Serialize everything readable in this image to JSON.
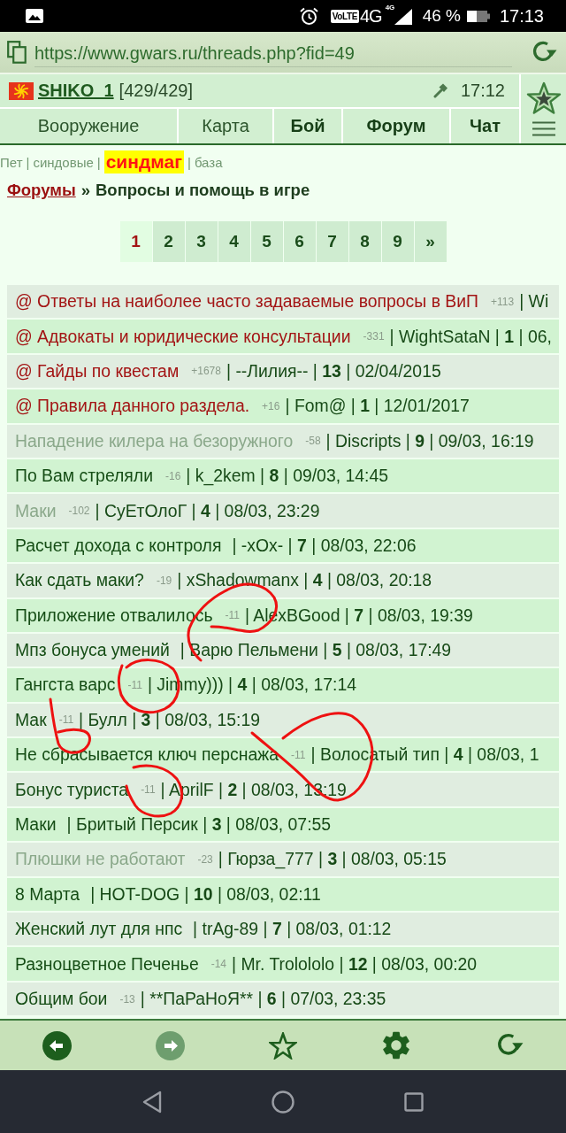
{
  "status_bar": {
    "volte": "VoLTE",
    "network": "4G",
    "network_badge": "4G",
    "battery": "46 %",
    "time": "17:13"
  },
  "address_bar": {
    "url": "https://www.gwars.ru/threads.php?fid=49"
  },
  "header": {
    "user": {
      "name": "SHIKO_1",
      "hp": "[429/429]"
    },
    "time": "17:12",
    "nav": [
      {
        "label": "Вооружение",
        "bold": false
      },
      {
        "label": "Карта",
        "bold": false
      },
      {
        "label": "Бой",
        "bold": true
      },
      {
        "label": "Форум",
        "bold": true
      },
      {
        "label": "Чат",
        "bold": true
      }
    ]
  },
  "quick_links": {
    "separator": "|",
    "items": [
      {
        "label": "Пет",
        "highlighted": false
      },
      {
        "label": "синдовые",
        "highlighted": false
      },
      {
        "label": "синдмаг",
        "highlighted": true
      },
      {
        "label": "база",
        "highlighted": false
      }
    ]
  },
  "breadcrumb": {
    "parent": "Форумы",
    "separator": "»",
    "current": "Вопросы и помощь в игре"
  },
  "pagination": [
    {
      "label": "1",
      "selected": true
    },
    {
      "label": "2",
      "selected": false
    },
    {
      "label": "3",
      "selected": false
    },
    {
      "label": "4",
      "selected": false
    },
    {
      "label": "5",
      "selected": false
    },
    {
      "label": "6",
      "selected": false
    },
    {
      "label": "7",
      "selected": false
    },
    {
      "label": "8",
      "selected": false
    },
    {
      "label": "9",
      "selected": false
    },
    {
      "label": "»",
      "selected": false
    }
  ],
  "thread_list": {
    "separator": "|",
    "rows": [
      {
        "kind": "pinned",
        "title": "@ Ответы на наиболее часто задаваемые вопросы в ВиП",
        "rating": "+113",
        "author": "Wi"
      },
      {
        "kind": "pinned",
        "title": "@ Адвокаты и юридические консультации",
        "rating": "-331",
        "author": "WightSataN",
        "replies": "1",
        "date": "06,"
      },
      {
        "kind": "pinned",
        "title": "@ Гайды по квестам",
        "rating": "+1678",
        "author": "--Лилия--",
        "replies": "13",
        "date": "02/04/2015"
      },
      {
        "kind": "pinned",
        "title": "@ Правила данного раздела.",
        "rating": "+16",
        "author": "Fom@",
        "replies": "1",
        "date": "12/01/2017"
      },
      {
        "kind": "faded",
        "title": "Нападение килера на безоружного",
        "rating": "-58",
        "author": "Discripts",
        "replies": "9",
        "date": "09/03, 16:19"
      },
      {
        "kind": "regular",
        "title": "По Вам стреляли",
        "rating": "-16",
        "author": "k_2kem",
        "replies": "8",
        "date": "09/03, 14:45"
      },
      {
        "kind": "faded",
        "title": "Маки",
        "rating": "-102",
        "author": "СуЕтОлоГ",
        "replies": "4",
        "date": "08/03, 23:29"
      },
      {
        "kind": "regular",
        "title": "Расчет дохода с контроля",
        "author": "-xOx-",
        "replies": "7",
        "date": "08/03, 22:06"
      },
      {
        "kind": "regular",
        "title": "Как сдать маки?",
        "rating": "-19",
        "author": "xShadowmanx",
        "replies": "4",
        "date": "08/03, 20:18"
      },
      {
        "kind": "regular",
        "title": "Приложение отвалилось",
        "rating": "-11",
        "author": "AlexBGood",
        "replies": "7",
        "date": "08/03, 19:39"
      },
      {
        "kind": "regular",
        "title": "Мпз бонуса умений",
        "author": "Варю Пельмени",
        "replies": "5",
        "date": "08/03, 17:49"
      },
      {
        "kind": "regular",
        "title": "Гангста варс",
        "rating": "-11",
        "author": "Jimmy)))",
        "replies": "4",
        "date": "08/03, 17:14"
      },
      {
        "kind": "regular",
        "title": "Мак",
        "rating": "-11",
        "author": "Булл",
        "replies": "3",
        "date": "08/03, 15:19"
      },
      {
        "kind": "regular",
        "title": "Не сбрасывается ключ перснажа",
        "rating": "-11",
        "author": "Волосатый тип",
        "replies": "4",
        "date": "08/03, 1"
      },
      {
        "kind": "regular",
        "title": "Бонус туриста",
        "rating": "-11",
        "author": "AprilF",
        "replies": "2",
        "date": "08/03, 13:19"
      },
      {
        "kind": "regular",
        "title": "Маки",
        "author": "Бритый Персик",
        "replies": "3",
        "date": "08/03, 07:55"
      },
      {
        "kind": "faded",
        "title": "Плюшки не работают",
        "rating": "-23",
        "author": "Гюрза_777",
        "replies": "3",
        "date": "08/03, 05:15"
      },
      {
        "kind": "regular",
        "title": "8 Марта",
        "author": "HOT-DOG",
        "replies": "10",
        "date": "08/03, 02:11"
      },
      {
        "kind": "regular",
        "title": "Женский лут для нпс",
        "author": "trAg-89",
        "replies": "7",
        "date": "08/03, 01:12"
      },
      {
        "kind": "regular",
        "title": "Разноцветное Печенье",
        "rating": "-14",
        "author": "Mr. Trolololo",
        "replies": "12",
        "date": "08/03, 00:20"
      },
      {
        "kind": "regular",
        "title": "Общим бои",
        "rating": "-13",
        "author": "**ПаРаНоЯ**",
        "replies": "6",
        "date": "07/03, 23:35"
      }
    ]
  },
  "toolbar": [
    {
      "kind": "back",
      "disabled": false
    },
    {
      "kind": "forward",
      "disabled": true
    },
    {
      "kind": "bookmark",
      "disabled": false
    },
    {
      "kind": "settings",
      "disabled": false
    },
    {
      "kind": "reload",
      "disabled": false
    }
  ]
}
